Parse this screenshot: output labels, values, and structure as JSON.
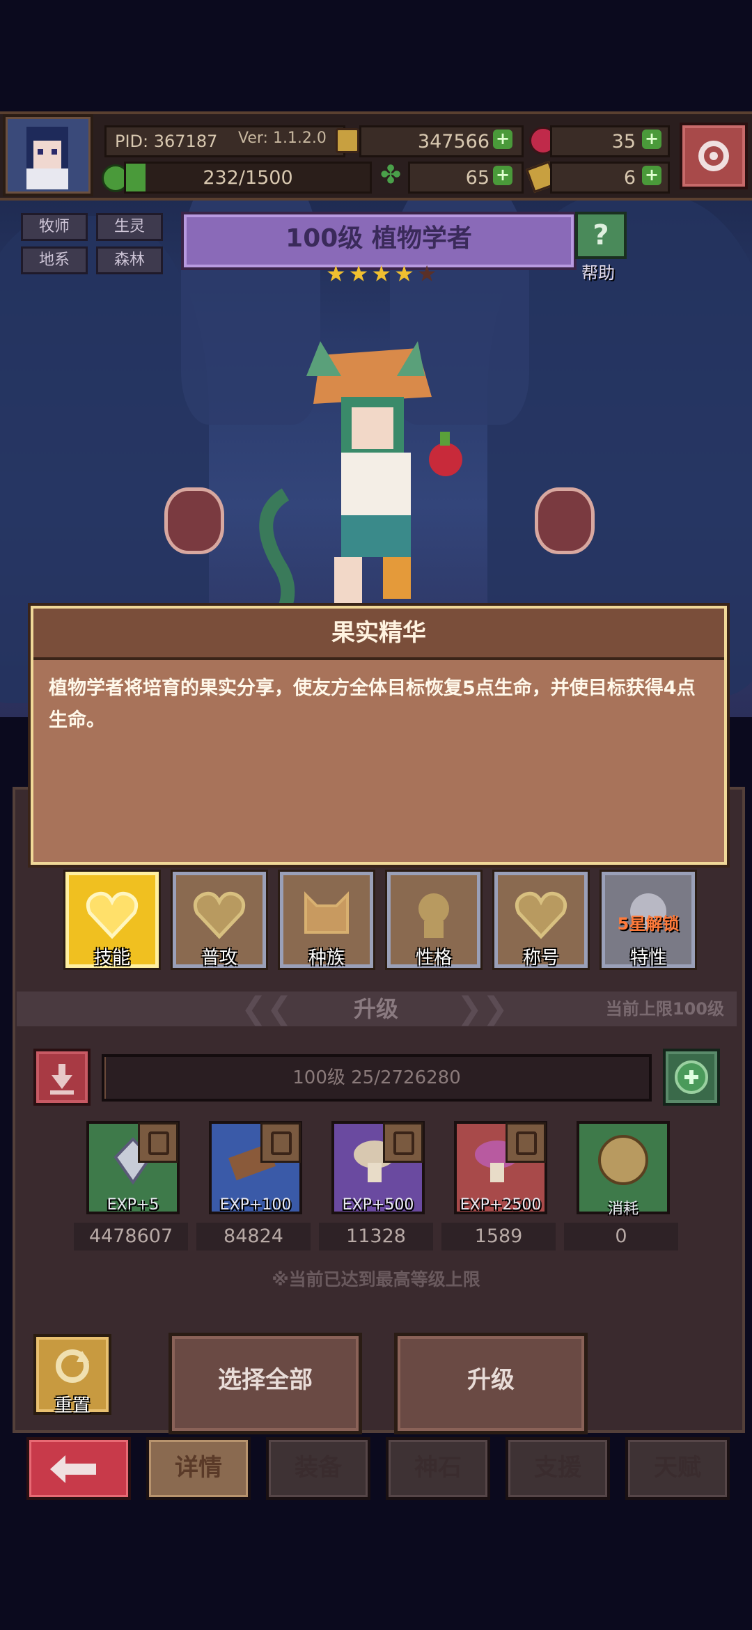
{
  "header": {
    "pid": "PID: 367187",
    "version": "Ver: 1.1.2.0",
    "gold": "347566",
    "gems": "35",
    "stamina": "232/1500",
    "clover": "65",
    "keys": "6",
    "settings_icon": "gear-icon"
  },
  "tags": [
    "牧师",
    "生灵",
    "地系",
    "森林"
  ],
  "character": {
    "title": "100级  植物学者",
    "stars": 4,
    "help_label": "帮助"
  },
  "skill_desc": {
    "title": "果实精华",
    "text": "植物学者将培育的果实分享，使友方全体目标恢复5点生命，并使目标获得4点生命。"
  },
  "tabs": [
    {
      "label": "技能",
      "active": true
    },
    {
      "label": "普攻",
      "active": false
    },
    {
      "label": "种族",
      "active": false
    },
    {
      "label": "性格",
      "active": false
    },
    {
      "label": "称号",
      "active": false
    },
    {
      "label": "特性",
      "active": false,
      "badge": "5星解锁"
    }
  ],
  "upgrade": {
    "header": "升级",
    "limit": "当前上限100级",
    "progress": "100级  25/2726280",
    "progress_fraction": 1e-05,
    "items": [
      {
        "label": "EXP+5",
        "qty": "4478607",
        "color": "#3e7a4a"
      },
      {
        "label": "EXP+100",
        "qty": "84824",
        "color": "#3a5aa8"
      },
      {
        "label": "EXP+500",
        "qty": "11328",
        "color": "#6a4aa0"
      },
      {
        "label": "EXP+2500",
        "qty": "1589",
        "color": "#a84a4a"
      },
      {
        "label": "消耗",
        "qty": "0",
        "color": "#3e7a4a"
      }
    ],
    "max_note": "※当前已达到最高等级上限",
    "reset_label": "重置",
    "select_all_label": "选择全部",
    "upgrade_label": "升级"
  },
  "bottom_nav": [
    "详情",
    "装备",
    "神石",
    "支援",
    "天赋"
  ],
  "colors": {
    "gold_tab": "#f0c020",
    "accent_green": "#4a9a3a",
    "back_red": "#c83a4a"
  }
}
